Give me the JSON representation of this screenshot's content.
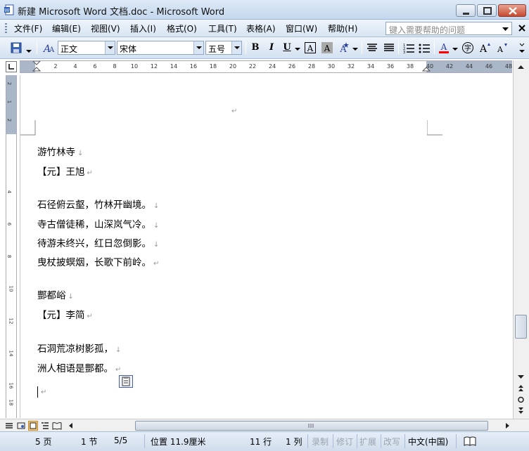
{
  "window": {
    "title": "新建 Microsoft Word 文档.doc - Microsoft Word"
  },
  "menu": {
    "items": [
      "文件(F)",
      "编辑(E)",
      "视图(V)",
      "插入(I)",
      "格式(O)",
      "工具(T)",
      "表格(A)",
      "窗口(W)",
      "帮助(H)"
    ],
    "help_placeholder": "键入需要帮助的问题"
  },
  "toolbar": {
    "style": "正文",
    "font": "宋体",
    "size": "五号",
    "bold": "B",
    "italic": "I",
    "underline": "U",
    "font_color": "#ff0000"
  },
  "ruler": {
    "ticks": [
      "2",
      "4",
      "6",
      "8",
      "10",
      "12",
      "14",
      "16",
      "18",
      "20",
      "22",
      "24",
      "26",
      "28",
      "30",
      "32",
      "34",
      "36",
      "38",
      "40",
      "42",
      "44",
      "46",
      "48"
    ],
    "vticks": [
      "2",
      "1",
      "2",
      "4",
      "6",
      "8",
      "10",
      "12",
      "14",
      "16",
      "18"
    ]
  },
  "document": {
    "lines": [
      {
        "text": "游竹林寺",
        "mark": "↓"
      },
      {
        "text": "【元】王旭",
        "mark": "↵"
      },
      {
        "text": "石径俯云壑，竹林开幽境。",
        "mark": "↓"
      },
      {
        "text": "寺古僧徒稀，山深岚气冷。",
        "mark": "↓"
      },
      {
        "text": "待游未终兴，红日忽倒影。",
        "mark": "↓"
      },
      {
        "text": "曳杖披螟烟，长歌下前岭。",
        "mark": "↵"
      },
      {
        "text": "酆都峪",
        "mark": "↓"
      },
      {
        "text": "【元】李简",
        "mark": "↵"
      },
      {
        "text": "石洞荒凉树影孤，",
        "mark": "↓"
      },
      {
        "text": "洲人相语是酆都。",
        "mark": "↵"
      }
    ],
    "top_mark": "↵",
    "cursor_mark": "↵"
  },
  "status": {
    "page": "5 页",
    "section": "1 节",
    "page_of": "5/5",
    "position": "位置 11.9厘米",
    "line": "11 行",
    "column": "1 列",
    "rec": "录制",
    "trk": "修订",
    "ext": "扩展",
    "ovr": "改写",
    "language": "中文(中国)"
  }
}
